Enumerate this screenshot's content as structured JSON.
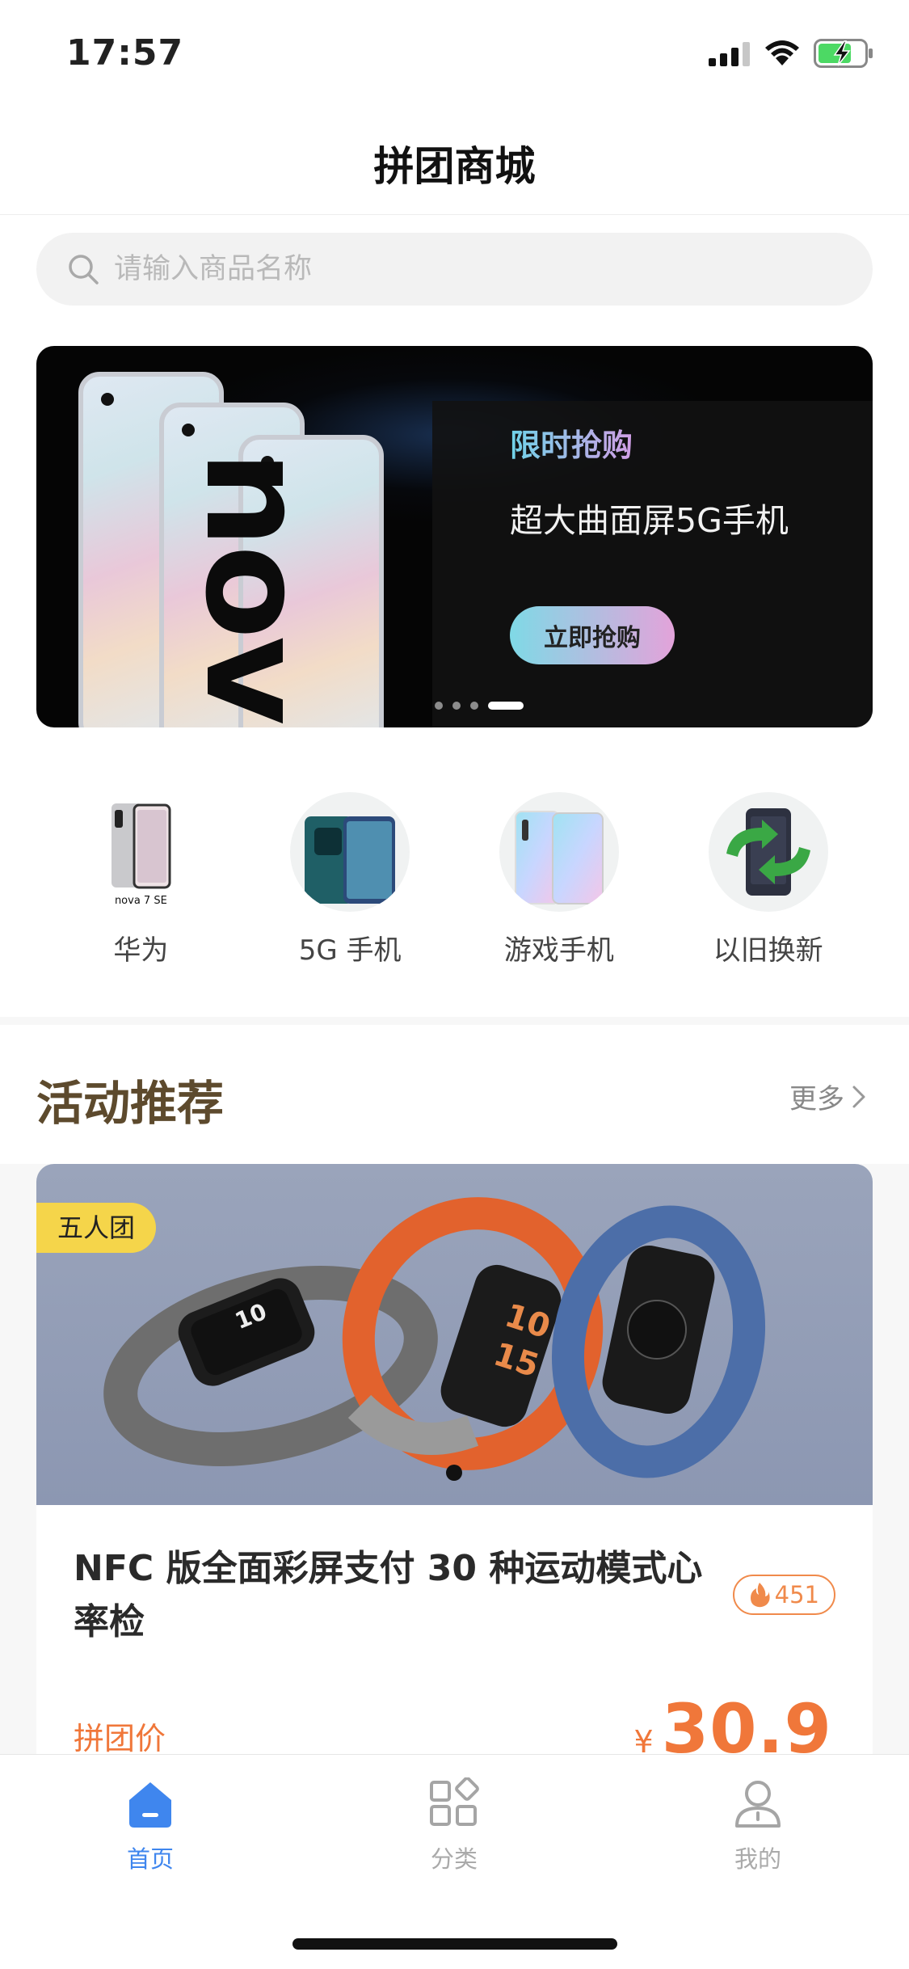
{
  "status_bar": {
    "time": "17:57"
  },
  "nav": {
    "title": "拼团商城"
  },
  "search": {
    "placeholder": "请输入商品名称"
  },
  "banner": {
    "phone_brand": "nova",
    "promo_title": "限时抢购",
    "promo_subtitle": "超大曲面屏5G手机",
    "cta_label": "立即抢购",
    "slide_count": 4,
    "active_slide": 4
  },
  "categories": [
    {
      "label": "华为",
      "icon": "huawei-phone-icon",
      "caption": "nova 7 SE"
    },
    {
      "label": "5G 手机",
      "icon": "5g-phone-icon"
    },
    {
      "label": "游戏手机",
      "icon": "gaming-phone-icon"
    },
    {
      "label": "以旧换新",
      "icon": "trade-in-icon"
    }
  ],
  "section": {
    "title": "活动推荐",
    "more_label": "更多"
  },
  "product": {
    "badge": "五人团",
    "name": "NFC 版全面彩屏支付 30 种运动模式心率检",
    "hot_count": "451",
    "price_label": "拼团价",
    "currency": "¥",
    "price": "30.9",
    "band_numbers": [
      "10",
      "10",
      "15"
    ]
  },
  "tabbar": {
    "items": [
      {
        "label": "首页",
        "icon": "home-icon",
        "active": true
      },
      {
        "label": "分类",
        "icon": "category-icon",
        "active": false
      },
      {
        "label": "我的",
        "icon": "profile-icon",
        "active": false
      }
    ]
  },
  "colors": {
    "accent": "#3f86ee",
    "price": "#f0773a",
    "badge": "#f5d54a",
    "section_title": "#5d4a2d"
  }
}
